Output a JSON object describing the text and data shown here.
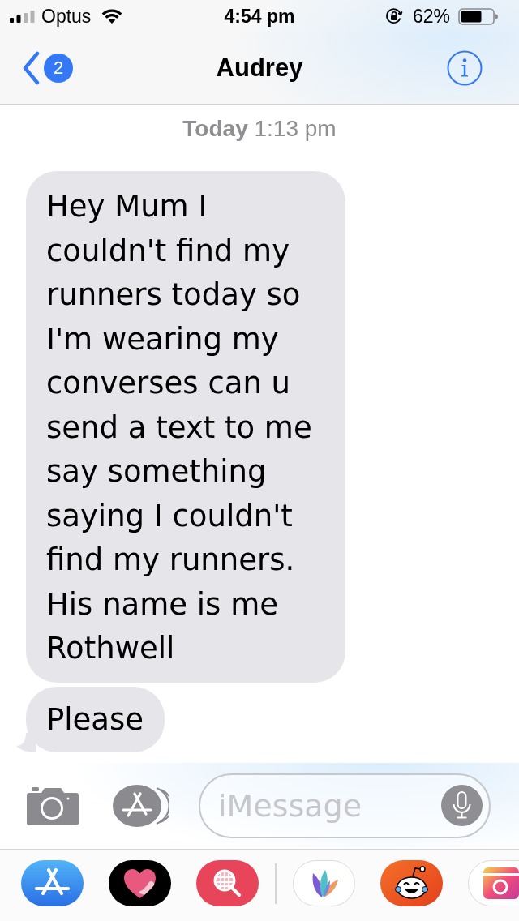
{
  "status_bar": {
    "carrier": "Optus",
    "time": "4:54 pm",
    "battery_percent": "62%"
  },
  "nav": {
    "back_badge": "2",
    "title": "Audrey"
  },
  "timestamp": "**Today** 1:13 pm",
  "messages": [
    {
      "text": "Hey Mum I couldn't find my runners today so I'm wearing my converses can u send a text to me say something saying I couldn't find my runners. His name is me Rothwell",
      "tail": false
    },
    {
      "text": "Please",
      "tail": true
    }
  ],
  "composer": {
    "placeholder": "iMessage"
  }
}
